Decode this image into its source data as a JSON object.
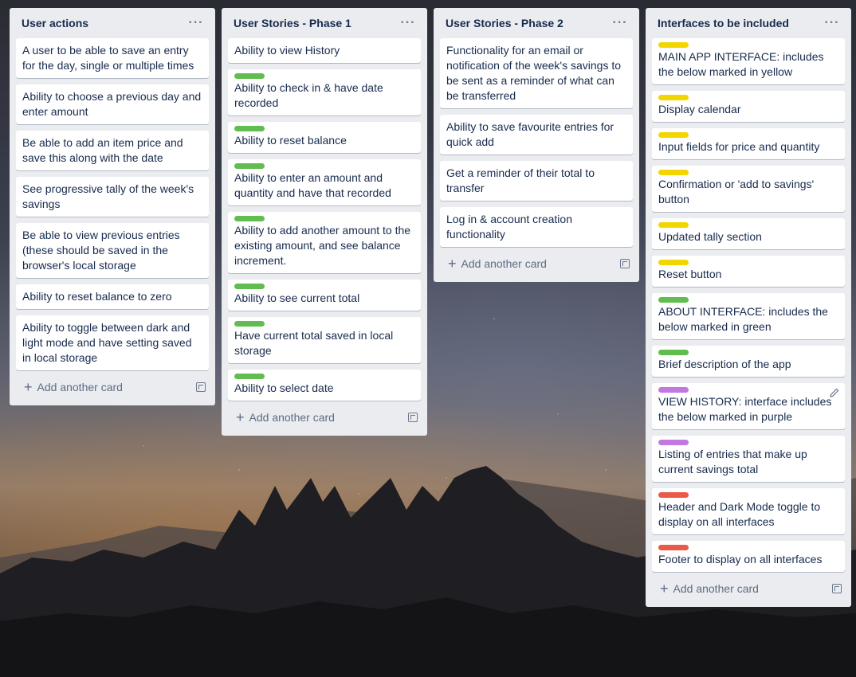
{
  "board": {
    "lists": [
      {
        "title": "User actions",
        "menu": "···",
        "cards": [
          {
            "label": null,
            "text": "A user to be able to save an entry for the day, single or multiple times"
          },
          {
            "label": null,
            "text": "Ability to choose a previous day and enter amount"
          },
          {
            "label": null,
            "text": "Be able to add an item price and save this along with the date"
          },
          {
            "label": null,
            "text": "See progressive tally of the week's savings"
          },
          {
            "label": null,
            "text": "Be able to view previous entries (these should be saved in the browser's local storage"
          },
          {
            "label": null,
            "text": "Ability to reset balance to zero"
          },
          {
            "label": null,
            "text": "Ability to toggle between dark and light mode and have setting saved in local storage"
          }
        ],
        "add_card": "Add another card"
      },
      {
        "title": "User Stories - Phase 1",
        "menu": "···",
        "cards": [
          {
            "label": null,
            "text": "Ability to view History"
          },
          {
            "label": "green",
            "text": "Ability to check in & have date recorded"
          },
          {
            "label": "green",
            "text": "Ability to reset balance"
          },
          {
            "label": "green",
            "text": "Ability to enter an amount and quantity and have that recorded"
          },
          {
            "label": "green",
            "text": "Ability to add another amount to the existing amount, and see balance increment."
          },
          {
            "label": "green",
            "text": "Ability to see current total"
          },
          {
            "label": "green",
            "text": "Have current total saved in local storage"
          },
          {
            "label": "green",
            "text": "Ability to select date"
          }
        ],
        "add_card": "Add another card"
      },
      {
        "title": "User Stories - Phase 2",
        "menu": "···",
        "cards": [
          {
            "label": null,
            "text": "Functionality for an email or notification of the week's savings to be sent as a reminder of what can be transferred"
          },
          {
            "label": null,
            "text": "Ability to save favourite entries for quick add"
          },
          {
            "label": null,
            "text": "Get a reminder of their total to transfer"
          },
          {
            "label": null,
            "text": "Log in & account creation functionality"
          }
        ],
        "add_card": "Add another card"
      },
      {
        "title": "Interfaces to be included",
        "menu": "···",
        "cards": [
          {
            "label": "yellow",
            "text": "MAIN APP INTERFACE: includes the below marked in yellow"
          },
          {
            "label": "yellow",
            "text": "Display calendar"
          },
          {
            "label": "yellow",
            "text": "Input fields for price and quantity"
          },
          {
            "label": "yellow",
            "text": "Confirmation or 'add to savings' button"
          },
          {
            "label": "yellow",
            "text": "Updated tally section"
          },
          {
            "label": "yellow",
            "text": "Reset button"
          },
          {
            "label": "green",
            "text": "ABOUT INTERFACE: includes the below marked in green"
          },
          {
            "label": "green",
            "text": "Brief description of the app"
          },
          {
            "label": "purple",
            "text": "VIEW HISTORY: interface includes the below marked in purple",
            "editing": true
          },
          {
            "label": "purple",
            "text": "Listing of entries that make up current savings total"
          },
          {
            "label": "red",
            "text": "Header and Dark Mode toggle to display on all interfaces"
          },
          {
            "label": "red",
            "text": "Footer to display on all interfaces"
          }
        ],
        "add_card": "Add another card"
      }
    ]
  },
  "colors": {
    "green": "#61bd4f",
    "yellow": "#f2d600",
    "purple": "#c377e0",
    "red": "#eb5a46",
    "list_bg": "#ebecf0"
  },
  "icons": {
    "list_menu": "ellipsis-icon",
    "add": "plus-icon",
    "template": "card-template-icon",
    "edit": "pencil-icon"
  }
}
